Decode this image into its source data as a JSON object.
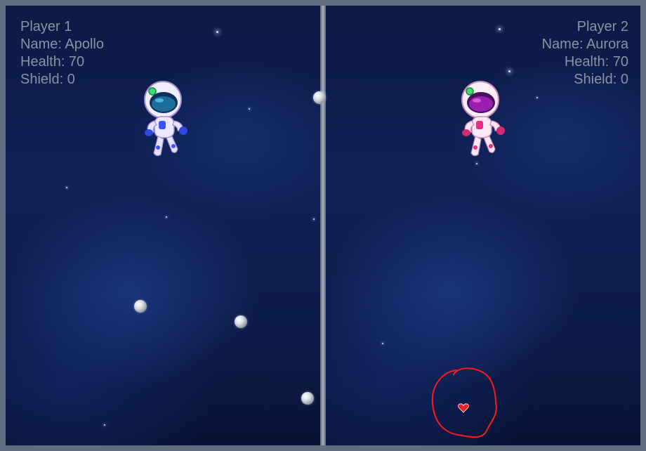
{
  "colors": {
    "space_bg": "#0f2156",
    "hud_text": "#8a93a3",
    "divider": "#9aa3ad",
    "annotation": "#ff1a1a",
    "heart": "#e8202a",
    "player1_accent": "#3a55ff",
    "player2_accent": "#e0307f"
  },
  "players": [
    {
      "header": "Player 1",
      "name": "Name: Apollo",
      "health": "Health: 70",
      "shield": "Shield: 0",
      "avatar": "astronaut-blue"
    },
    {
      "header": "Player 2",
      "name": "Name: Aurora",
      "health": "Health: 70",
      "shield": "Shield: 0",
      "avatar": "astronaut-pink"
    }
  ],
  "pickups": [
    {
      "type": "heart-icon",
      "pane": "player-2"
    }
  ],
  "obstacles": [
    {
      "type": "asteroid-icon"
    },
    {
      "type": "asteroid-icon"
    },
    {
      "type": "asteroid-icon"
    },
    {
      "type": "asteroid-icon"
    }
  ]
}
